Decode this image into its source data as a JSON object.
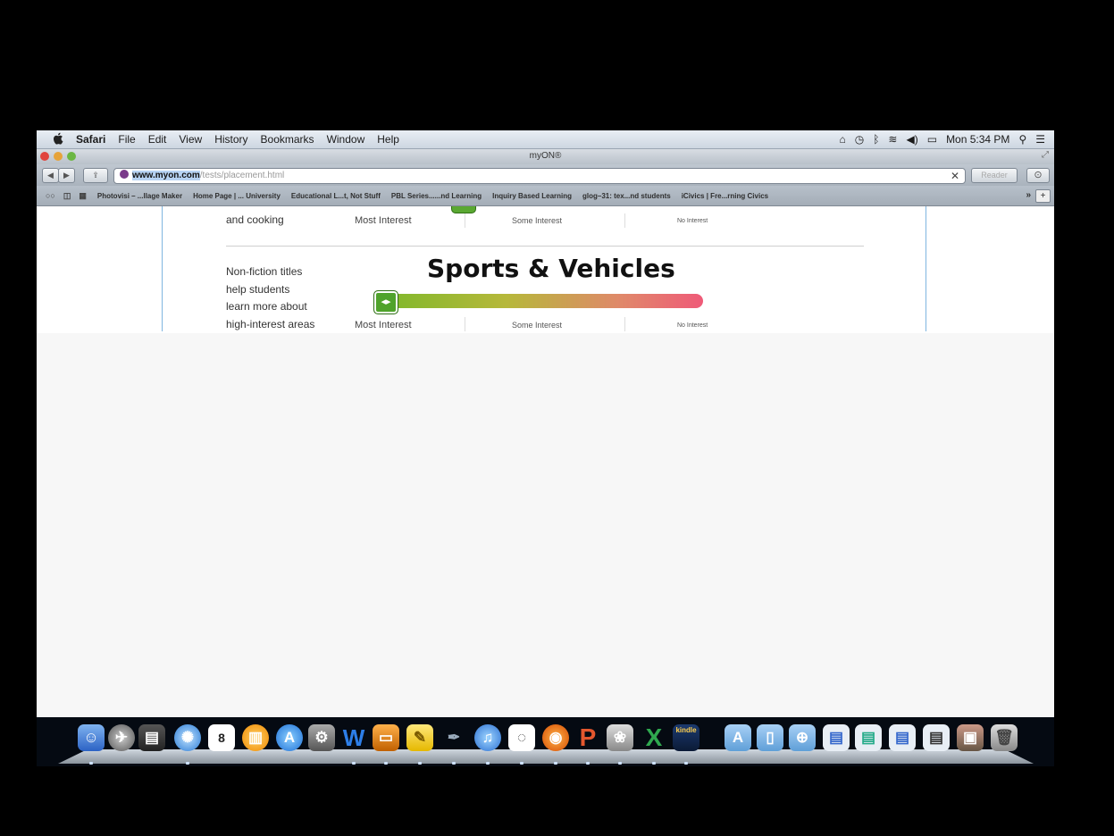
{
  "menubar": {
    "apple": "",
    "items": [
      "Safari",
      "File",
      "Edit",
      "View",
      "History",
      "Bookmarks",
      "Window",
      "Help"
    ],
    "status_time": "Mon 5:34 PM"
  },
  "window": {
    "title": "myON®"
  },
  "toolbar": {
    "url_domain": "www.myon.com",
    "url_path": "/tests/placement.html",
    "reader_label": "Reader"
  },
  "bookmarks": {
    "items": [
      "Photovisi – ...llage Maker",
      "Home Page | ... University",
      "Educational L...t, Not Stuff",
      "PBL Series......nd Learning",
      "Inquiry Based Learning",
      "glog–31: tex...nd students",
      "iCivics | Fre...rning Civics"
    ],
    "more": "»",
    "add": "+"
  },
  "page": {
    "prev_section": {
      "side_line1": "and cooking",
      "label_most": "Most Interest",
      "label_some": "Some Interest",
      "label_none": "No Interest"
    },
    "section": {
      "heading": "Sports & Vehicles",
      "side": [
        "Non-fiction titles",
        "help students",
        "learn more about",
        "high-interest areas"
      ],
      "label_most": "Most Interest",
      "label_some": "Some Interest",
      "label_none": "No Interest",
      "slider_value": 0
    }
  },
  "dock": {
    "icons": [
      "finder-icon",
      "launchpad-icon",
      "mission-control-icon",
      "safari-icon",
      "calendar-icon",
      "ibooks-icon",
      "app-store-icon",
      "system-preferences-icon",
      "word-icon",
      "keynote-icon",
      "stickies-icon",
      "quill-icon",
      "itunes-icon",
      "preview-icon",
      "firefox-icon",
      "powerpoint-icon",
      "photo-icon",
      "excel-icon",
      "kindle-icon",
      "applications-folder-icon",
      "documents-folder-icon",
      "downloads-folder-icon",
      "doc-stack-icon-1",
      "doc-stack-icon-2",
      "doc-stack-icon-3",
      "doc-stack-icon-4",
      "photos-stack-icon",
      "trash-icon"
    ],
    "calendar_day": "8",
    "word_letter": "W",
    "excel_letter": "X",
    "powerpoint_letter": "P",
    "kindle_label": "kindle"
  },
  "colors": {
    "slider_start": "#7bb82a",
    "slider_end": "#ef5a78",
    "handle": "#4fa32b"
  }
}
